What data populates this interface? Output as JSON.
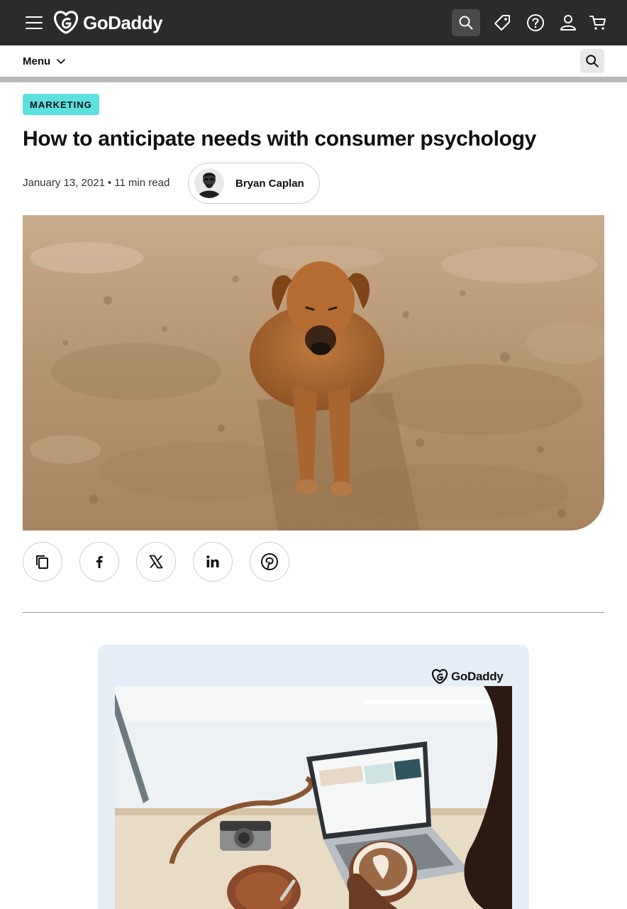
{
  "header": {
    "brand": "GoDaddy",
    "icons": [
      "menu-icon",
      "search-icon",
      "tag-icon",
      "help-icon",
      "account-icon",
      "cart-icon"
    ]
  },
  "menubar": {
    "menu_label": "Menu"
  },
  "article": {
    "category": "MARKETING",
    "title": "How to anticipate needs with consumer psychology",
    "date": "January 13, 2021",
    "separator": "•",
    "read_time": "11 min read",
    "author": "Bryan Caplan"
  },
  "share": {
    "icons": [
      "copy-link-icon",
      "facebook-icon",
      "x-icon",
      "linkedin-icon",
      "pinterest-icon"
    ]
  },
  "promo": {
    "brand": "GoDaddy"
  },
  "colors": {
    "topbar": "#2b2b2b",
    "category_badge": "#5de0e0",
    "promo_bg": "#e6eef8"
  }
}
